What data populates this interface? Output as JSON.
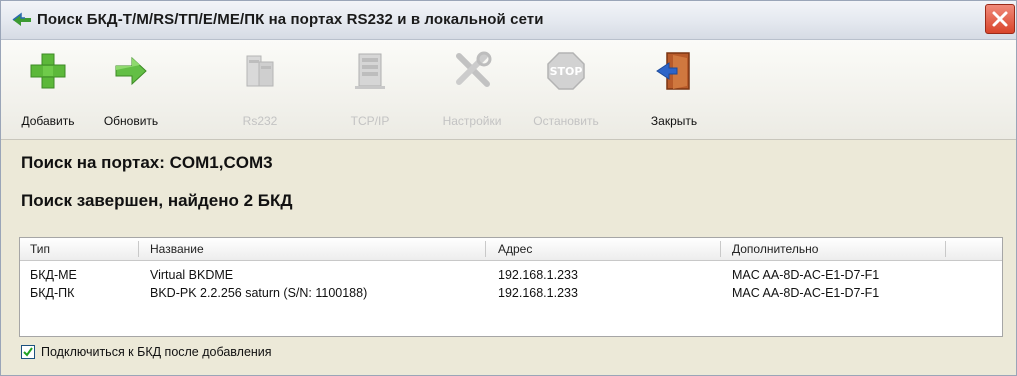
{
  "window": {
    "title": "Поиск БКД-Т/М/RS/ТП/Е/МЕ/ПК на портах RS232 и в локальной сети"
  },
  "toolbar": {
    "buttons": [
      {
        "label": "Добавить",
        "icon": "add-plus-icon",
        "enabled": true
      },
      {
        "label": "Обновить",
        "icon": "refresh-arrow-icon",
        "enabled": true
      },
      {
        "label": "Rs232",
        "icon": "rs232-devices-icon",
        "enabled": false
      },
      {
        "label": "TCP/IP",
        "icon": "network-server-icon",
        "enabled": false
      },
      {
        "label": "Настройки",
        "icon": "tools-icon",
        "enabled": false
      },
      {
        "label": "Остановить",
        "icon": "stop-icon",
        "enabled": false
      },
      {
        "label": "Закрыть",
        "icon": "exit-door-icon",
        "enabled": true
      }
    ]
  },
  "status": {
    "ports_line": "Поиск на портах: COM1,COM3",
    "result_line": "Поиск завершен, найдено 2 БКД"
  },
  "table": {
    "columns": [
      "Тип",
      "Название",
      "Адрес",
      "Дополнительно"
    ],
    "rows": [
      [
        "БКД-МЕ",
        "Virtual BKDME",
        "192.168.1.233",
        "MAC AA-8D-AC-E1-D7-F1"
      ],
      [
        "БКД-ПК",
        "BKD-PK 2.2.256 saturn (S/N: 1100188)",
        "192.168.1.233",
        "MAC AA-8D-AC-E1-D7-F1"
      ]
    ]
  },
  "options": {
    "connect_after_add_label": "Подключиться к БКД после добавления",
    "connect_after_add_checked": true
  },
  "colors": {
    "accent_green": "#5cb83a",
    "close_red": "#d9442a",
    "disabled_text": "#c3c3c3"
  }
}
